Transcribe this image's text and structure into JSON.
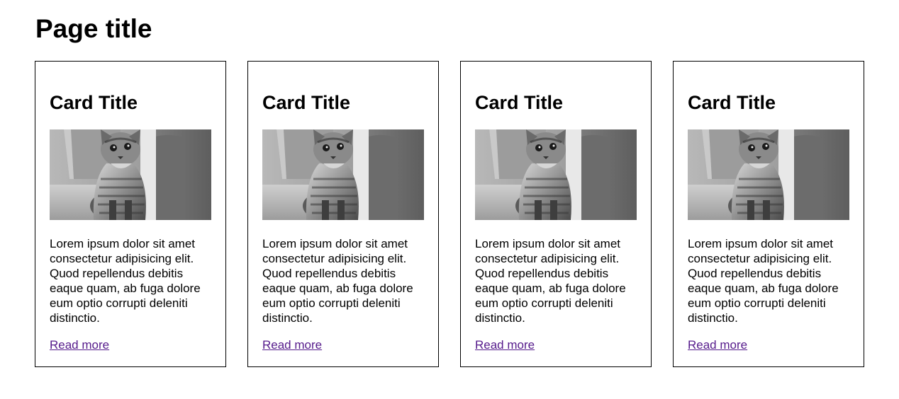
{
  "page": {
    "title": "Page title"
  },
  "cards": [
    {
      "title": "Card Title",
      "image_subject": "kitten-photo",
      "text": "Lorem ipsum dolor sit amet consectetur adipisicing elit. Quod repellendus debitis eaque quam, ab fuga dolore eum optio corrupti deleniti distinctio.",
      "link_label": "Read more"
    },
    {
      "title": "Card Title",
      "image_subject": "kitten-photo",
      "text": "Lorem ipsum dolor sit amet consectetur adipisicing elit. Quod repellendus debitis eaque quam, ab fuga dolore eum optio corrupti deleniti distinctio.",
      "link_label": "Read more"
    },
    {
      "title": "Card Title",
      "image_subject": "kitten-photo",
      "text": "Lorem ipsum dolor sit amet consectetur adipisicing elit. Quod repellendus debitis eaque quam, ab fuga dolore eum optio corrupti deleniti distinctio.",
      "link_label": "Read more"
    },
    {
      "title": "Card Title",
      "image_subject": "kitten-photo",
      "text": "Lorem ipsum dolor sit amet consectetur adipisicing elit. Quod repellendus debitis eaque quam, ab fuga dolore eum optio corrupti deleniti distinctio.",
      "link_label": "Read more"
    }
  ],
  "colors": {
    "link": "#551a8b",
    "border": "#000000"
  }
}
